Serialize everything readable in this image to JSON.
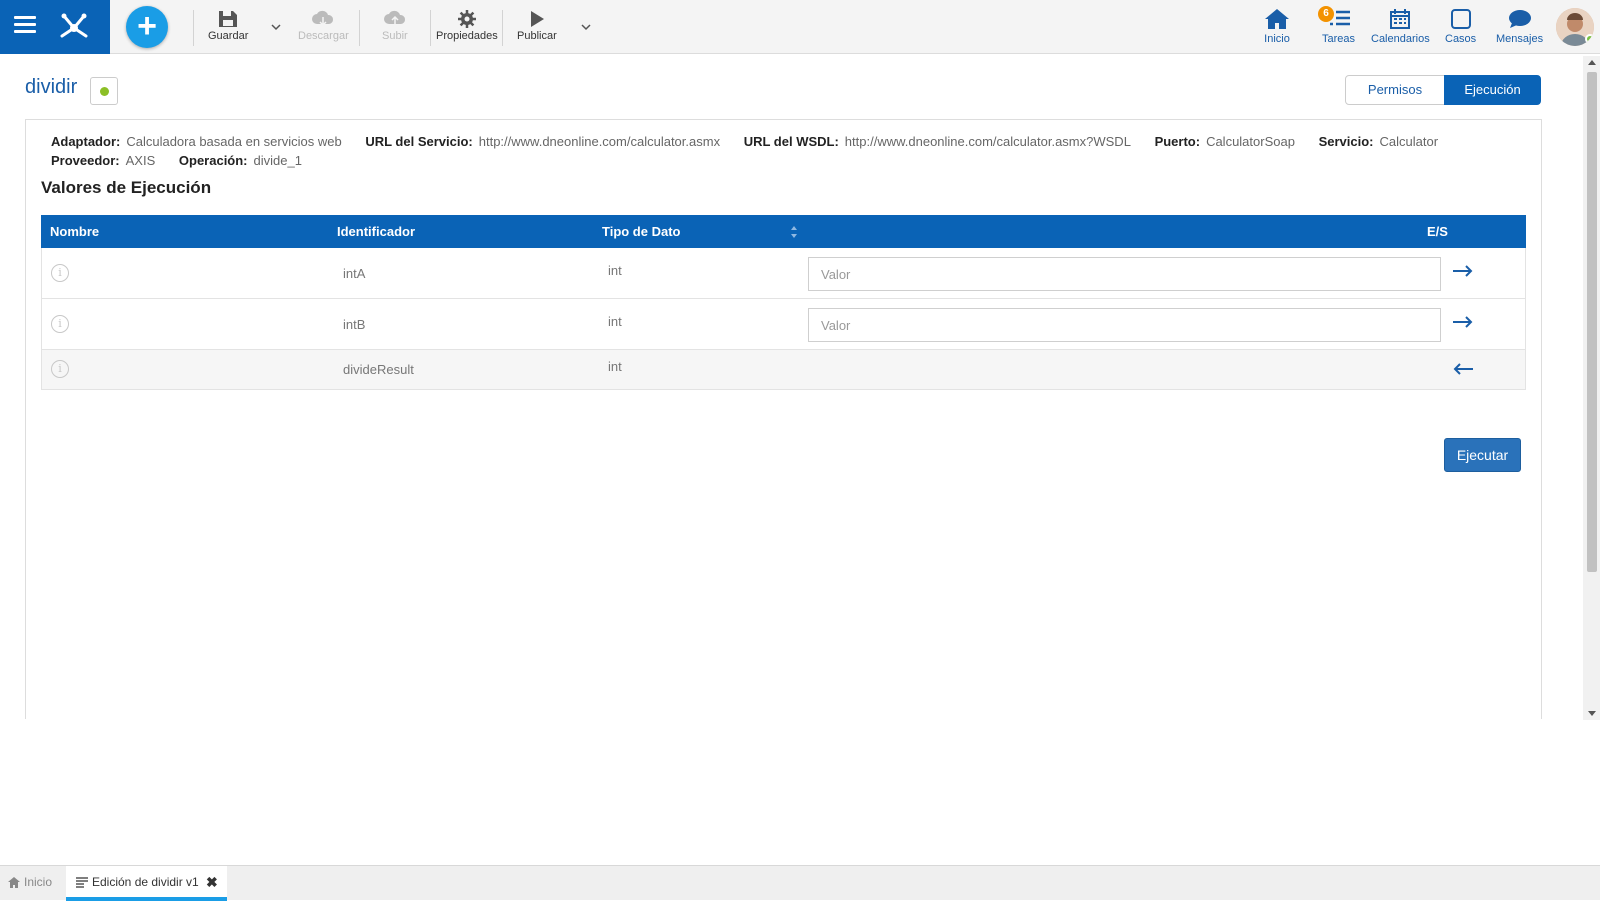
{
  "toolbar": {
    "save": "Guardar",
    "download": "Descargar",
    "upload": "Subir",
    "properties": "Propiedades",
    "publish": "Publicar"
  },
  "nav": {
    "home": "Inicio",
    "tasks": "Tareas",
    "tasks_badge": "6",
    "calendars": "Calendarios",
    "cases": "Casos",
    "messages": "Mensajes"
  },
  "page": {
    "title": "dividir",
    "tab_permissions": "Permisos",
    "tab_execution": "Ejecución"
  },
  "meta": {
    "adapter_label": "Adaptador:",
    "adapter_value": "Calculadora basada en servicios web",
    "service_url_label": "URL del Servicio:",
    "service_url_value": "http://www.dneonline.com/calculator.asmx",
    "wsdl_label": "URL del WSDL:",
    "wsdl_value": "http://www.dneonline.com/calculator.asmx?WSDL",
    "port_label": "Puerto:",
    "port_value": "CalculatorSoap",
    "service_label": "Servicio:",
    "service_value": "Calculator",
    "provider_label": "Proveedor:",
    "provider_value": "AXIS",
    "operation_label": "Operación:",
    "operation_value": "divide_1"
  },
  "section_title": "Valores de Ejecución",
  "table": {
    "columns": [
      "Nombre",
      "Identificador",
      "Tipo de Dato",
      "E/S"
    ],
    "rows": [
      {
        "name": "",
        "identifier": "intA",
        "type": "int",
        "placeholder": "Valor",
        "direction": "in"
      },
      {
        "name": "",
        "identifier": "intB",
        "type": "int",
        "placeholder": "Valor",
        "direction": "in"
      },
      {
        "name": "",
        "identifier": "divideResult",
        "type": "int",
        "direction": "out"
      }
    ]
  },
  "run_button": "Ejecutar",
  "bottom_tabs": {
    "home": "Inicio",
    "active": "Edición de dividir v1"
  },
  "colors": {
    "primary": "#0a63b6",
    "accent": "#1a9de6",
    "badge": "#f39200",
    "status_ok": "#8cbf26"
  }
}
